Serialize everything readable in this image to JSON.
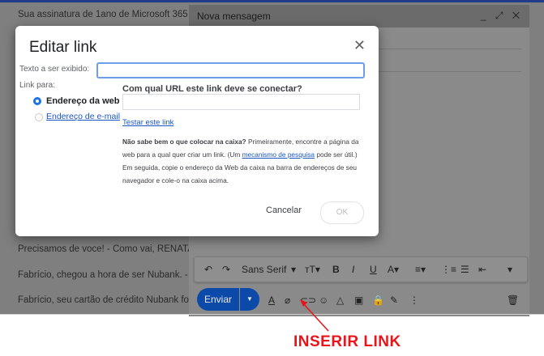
{
  "inbox": {
    "rows": [
      "Sua assinatura de 1ano de Microsoft 365",
      "Precisamos de voce! - Como vai, RENATA",
      "Fabrício, chegou a hora de ser Nubank. -",
      "Fabrício, seu cartão de crédito Nubank fo"
    ]
  },
  "compose": {
    "title": "Nova mensagem",
    "window_controls": "_ ⤢ ✕",
    "format_toolbar": {
      "undo": "↶",
      "redo": "↷",
      "font": "Sans Serif",
      "font_arrow": "▾",
      "size": "ᴛT▾",
      "bold": "B",
      "italic": "I",
      "underline": "U",
      "text_color": "A▾",
      "align": "≡▾",
      "numbered_list": "⋮≡",
      "bulleted_list": "☰",
      "indent": "⇤",
      "more": "▾"
    },
    "send_label": "Enviar",
    "send_arrow": "▼",
    "bottom_icons": {
      "format": "A",
      "attach": "⌀",
      "link": "⊂⊃",
      "emoji": "☺",
      "drive": "△",
      "photo": "▣",
      "lock": "🔒",
      "signature": "✎",
      "more": "⋮",
      "trash": "🗑"
    }
  },
  "dialog": {
    "title": "Editar link",
    "close": "✕",
    "text_label": "Texto a ser exibido:",
    "text_value": "",
    "link_to_label": "Link para:",
    "options": [
      "Endereço da web",
      "Endereço de e-mail"
    ],
    "url_heading": "Com qual URL este link deve se conectar?",
    "url_value": "",
    "test_link": "Testar este link",
    "help_bold": "Não sabe bem o que colocar na caixa?",
    "help_1": " Primeiramente, encontre a página da web para a qual quer criar um link. (Um ",
    "help_link": "mecanismo de pesquisa",
    "help_2": " pode ser útil.) Em seguida, copie o endereço da Web da caixa na barra de endereços de seu navegador e cole-o na caixa acima.",
    "cancel": "Cancelar",
    "ok": "OK"
  },
  "callout": {
    "text": "INSERIR LINK",
    "color": "#e8141a"
  },
  "colors": {
    "accent": "#1a73e8",
    "send_button": "#0b4aa8"
  }
}
